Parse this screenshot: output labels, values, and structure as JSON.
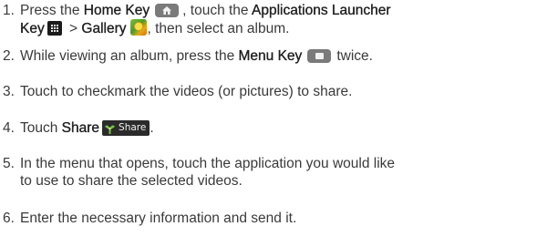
{
  "steps": [
    {
      "number": "1.",
      "line1": {
        "t1": "Press the ",
        "b1": "Home Key",
        "t2": ", touch the ",
        "b2": "Applications Launcher"
      },
      "line2": {
        "b1": "Key",
        "t1": " > ",
        "b2": "Gallery",
        "t2": ", then select an album."
      }
    },
    {
      "number": "2.",
      "line1": {
        "t1": "While viewing an album, press the ",
        "b1": "Menu Key",
        "t2": "twice."
      }
    },
    {
      "number": "3.",
      "line1": {
        "t1": "Touch to checkmark the videos (or pictures) to share."
      }
    },
    {
      "number": "4.",
      "line1": {
        "t1": "Touch ",
        "b1": "Share",
        "tag": "Share",
        "t2": "."
      }
    },
    {
      "number": "5.",
      "line1": {
        "t1": "In the menu that opens, touch the application you would like"
      },
      "line2": {
        "t1": "to use to share the selected videos."
      }
    },
    {
      "number": "6.",
      "line1": {
        "t1": "Enter the necessary information and send it."
      }
    }
  ],
  "icons": {
    "home_key": "home-key-icon",
    "apps_key": "applications-launcher-key-icon",
    "gallery": "gallery-app-icon",
    "menu_key": "menu-key-icon",
    "share": "share-icon"
  }
}
